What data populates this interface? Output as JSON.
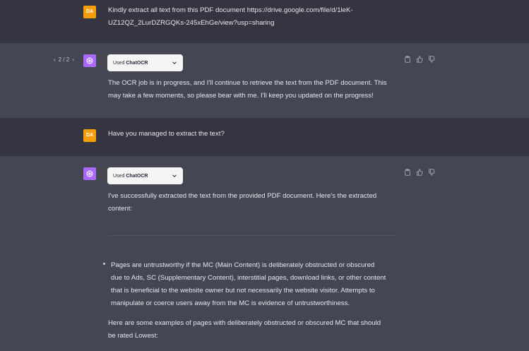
{
  "messages": [
    {
      "role": "user",
      "avatar_initials": "DA",
      "text": "Kindly extract all text from this PDF document https://drive.google.com/file/d/1leK-\nUZ12QZ_2LurDZRGQKs-245xEhGe/view?usp=sharing"
    },
    {
      "role": "assistant",
      "pager": {
        "prev": "‹",
        "label": "2 / 2",
        "next": "›"
      },
      "plugin": {
        "used": "Used",
        "name": "ChatOCR",
        "chevron": "⌄"
      },
      "text": "The OCR job is in progress, and I'll continue to retrieve the text from the PDF document. This\nmay take a few moments, so please bear with me. I'll keep you updated on the progress!"
    },
    {
      "role": "user",
      "avatar_initials": "DA",
      "text": "Have you managed to extract the text?"
    },
    {
      "role": "assistant",
      "plugin": {
        "used": "Used",
        "name": "ChatOCR",
        "chevron": "⌄"
      },
      "text": "I've successfully extracted the text from the provided PDF document. Here's the extracted\ncontent:",
      "bullet": "Pages are untrustworthy if the MC (Main Content) is deliberately obstructed or obscured\ndue to Ads, SC (Supplementary Content), interstitial pages, download links, or other content\nthat is beneficial to the website owner but not necessarily the website visitor. Attempts to\nmanipulate or coerce users away from the MC is evidence of untrustworthiness.",
      "paragraph": "Here are some examples of pages with deliberately obstructed or obscured MC that should\nbe rated Lowest:"
    }
  ],
  "colors": {
    "user_bg": "#343541",
    "assistant_bg": "#444654",
    "user_avatar": "#f59e0b",
    "assistant_avatar": "#ab68ff",
    "pill_bg": "#f5f5f5"
  },
  "icons": [
    "openai-logo-icon",
    "clipboard-icon",
    "thumbs-up-icon",
    "thumbs-down-icon",
    "chevron-down-icon"
  ]
}
